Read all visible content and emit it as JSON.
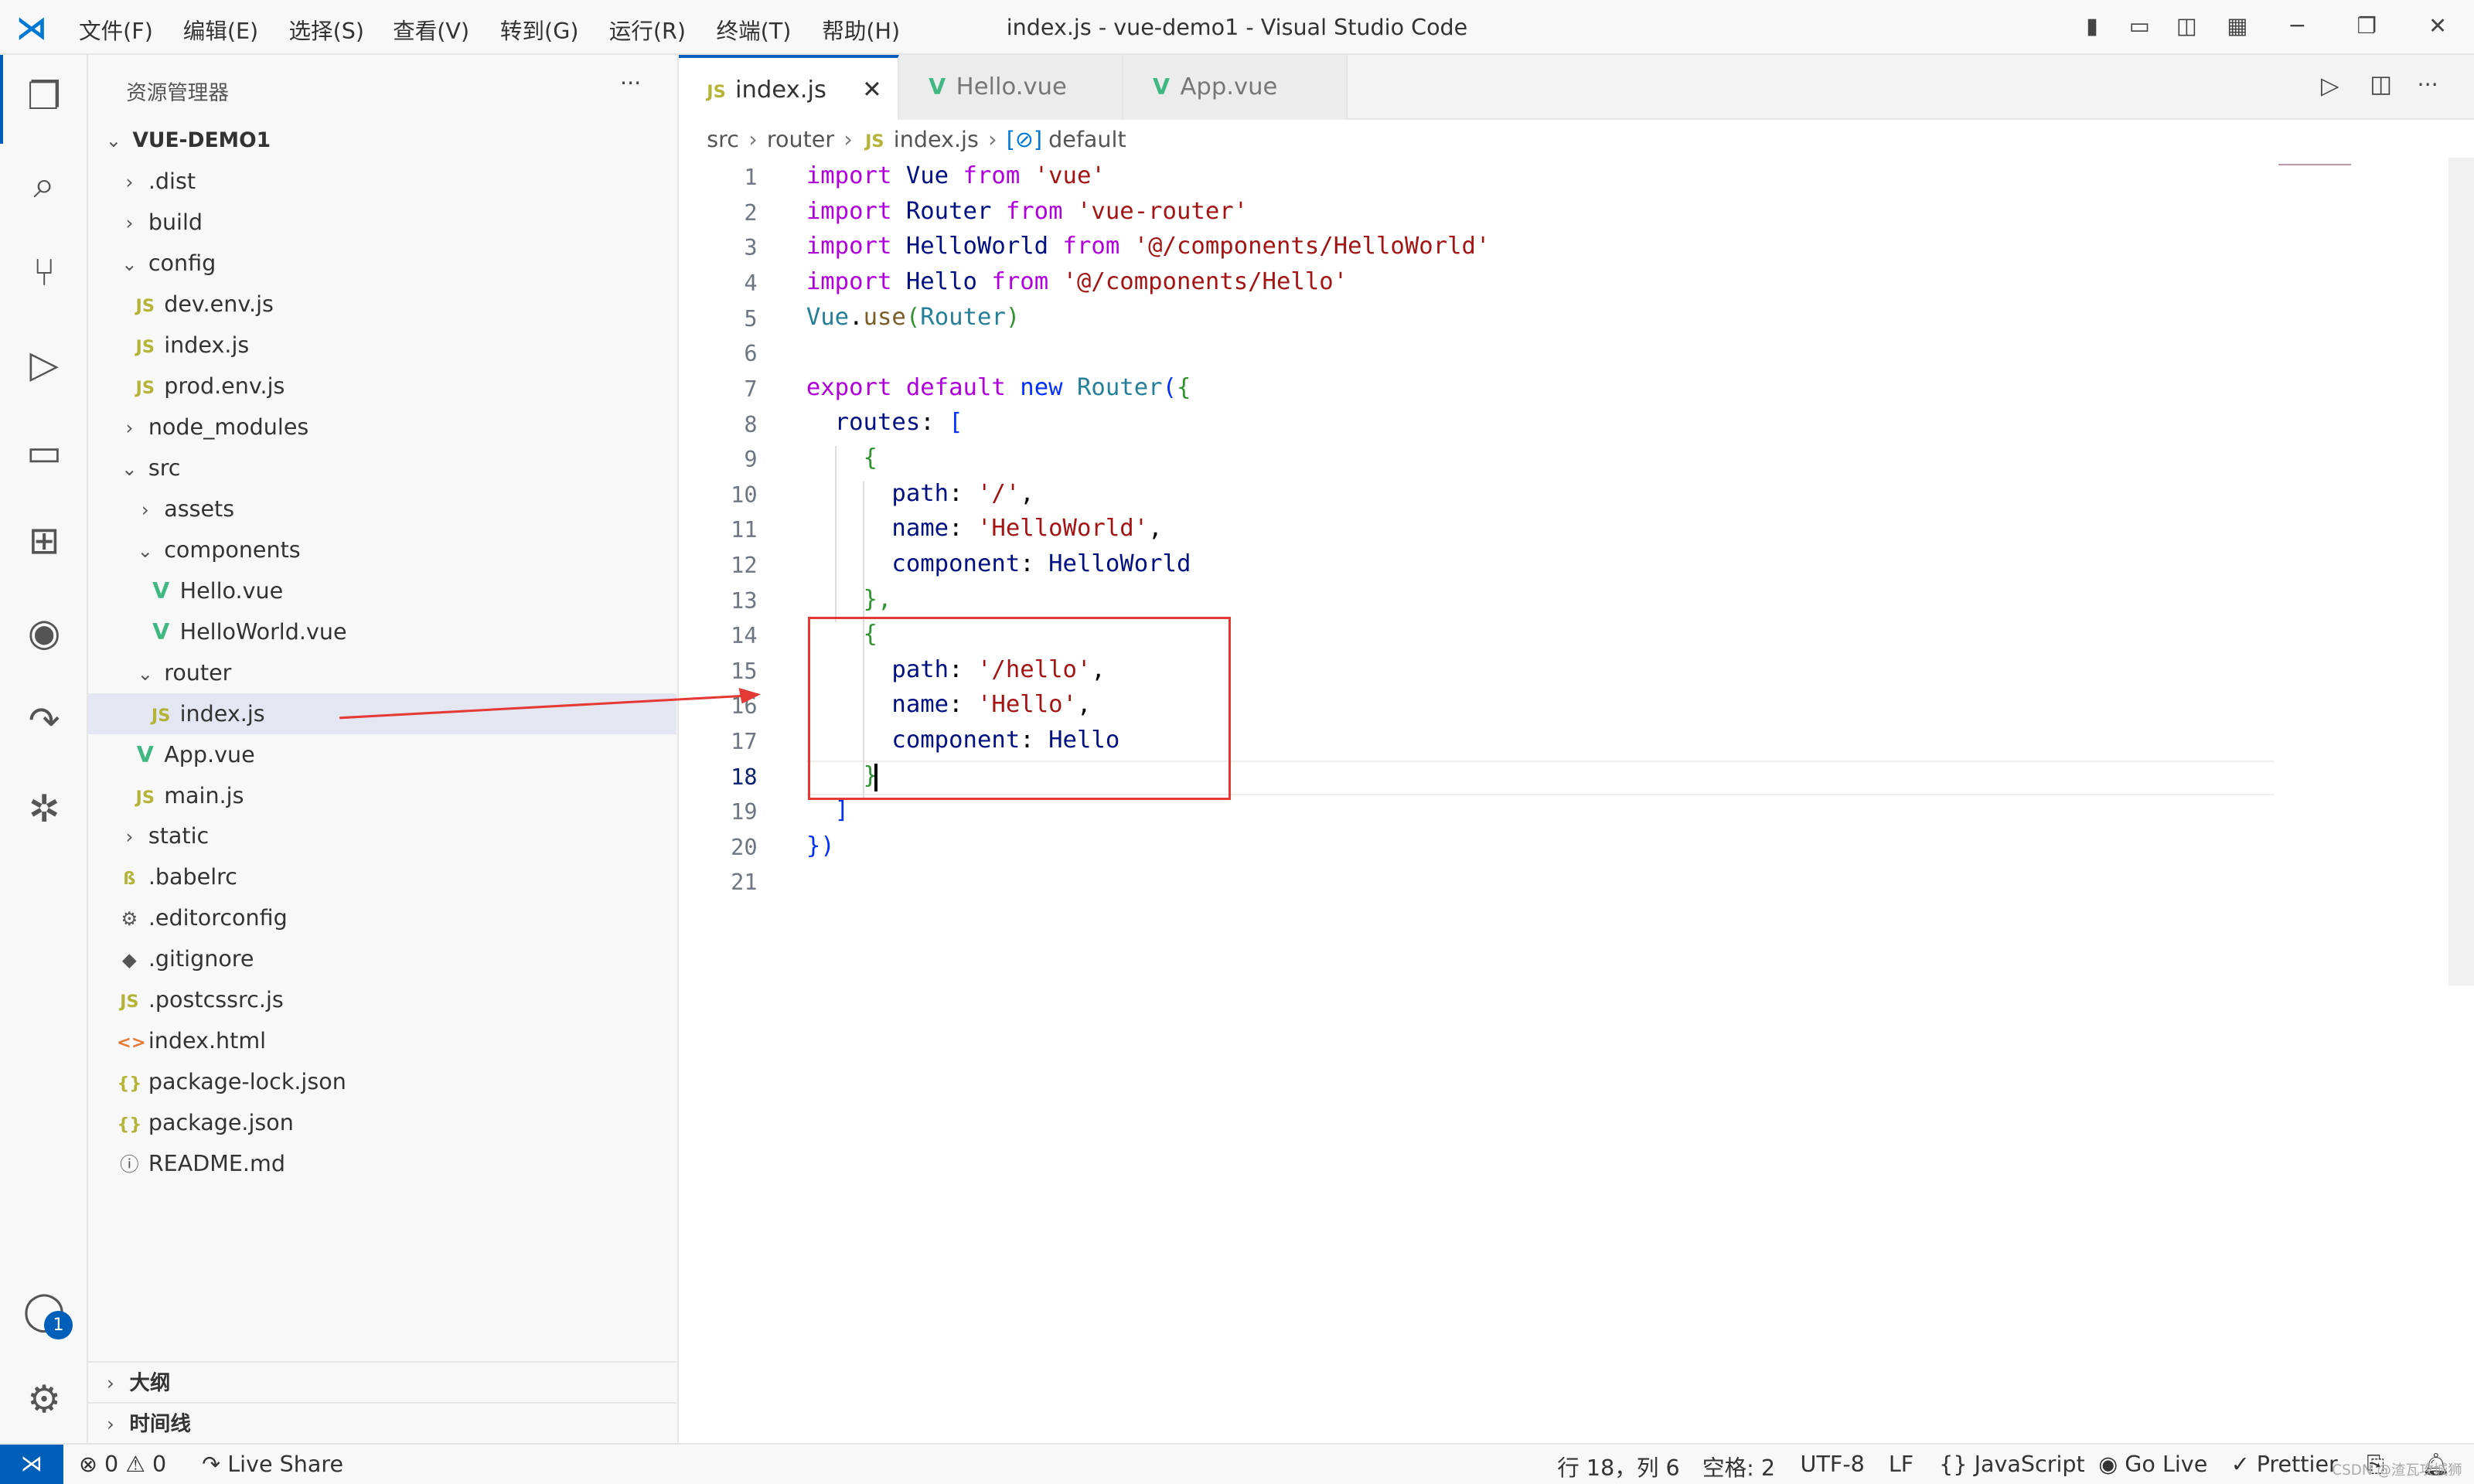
{
  "titlebar": {
    "menus": [
      "文件(F)",
      "编辑(E)",
      "选择(S)",
      "查看(V)",
      "转到(G)",
      "运行(R)",
      "终端(T)",
      "帮助(H)"
    ],
    "title": "index.js - vue-demo1 - Visual Studio Code"
  },
  "sidebar": {
    "header": "资源管理器",
    "more": "···",
    "root": "VUE-DEMO1",
    "items": [
      {
        "label": ".dist",
        "icon": "chevron-right",
        "depth": 1
      },
      {
        "label": "build",
        "icon": "chevron-right",
        "depth": 1
      },
      {
        "label": "config",
        "icon": "chevron-down",
        "depth": 1
      },
      {
        "label": "dev.env.js",
        "icon": "js",
        "depth": 2
      },
      {
        "label": "index.js",
        "icon": "js",
        "depth": 2
      },
      {
        "label": "prod.env.js",
        "icon": "js",
        "depth": 2
      },
      {
        "label": "node_modules",
        "icon": "chevron-right",
        "depth": 1
      },
      {
        "label": "src",
        "icon": "chevron-down",
        "depth": 1
      },
      {
        "label": "assets",
        "icon": "chevron-right",
        "depth": 2
      },
      {
        "label": "components",
        "icon": "chevron-down",
        "depth": 2
      },
      {
        "label": "Hello.vue",
        "icon": "vue",
        "depth": 3
      },
      {
        "label": "HelloWorld.vue",
        "icon": "vue",
        "depth": 3
      },
      {
        "label": "router",
        "icon": "chevron-down",
        "depth": 2
      },
      {
        "label": "index.js",
        "icon": "js",
        "depth": 3,
        "selected": true
      },
      {
        "label": "App.vue",
        "icon": "vue",
        "depth": 2
      },
      {
        "label": "main.js",
        "icon": "js",
        "depth": 2
      },
      {
        "label": "static",
        "icon": "chevron-right",
        "depth": 1
      },
      {
        "label": ".babelrc",
        "icon": "babel",
        "depth": 1
      },
      {
        "label": ".editorconfig",
        "icon": "gear",
        "depth": 1
      },
      {
        "label": ".gitignore",
        "icon": "git",
        "depth": 1
      },
      {
        "label": ".postcssrc.js",
        "icon": "js",
        "depth": 1
      },
      {
        "label": "index.html",
        "icon": "html",
        "depth": 1
      },
      {
        "label": "package-lock.json",
        "icon": "json",
        "depth": 1
      },
      {
        "label": "package.json",
        "icon": "json",
        "depth": 1
      },
      {
        "label": "README.md",
        "icon": "info",
        "depth": 1
      }
    ],
    "outline": "大纲",
    "timeline": "时间线"
  },
  "tabs": [
    {
      "label": "index.js",
      "icon": "js",
      "active": true
    },
    {
      "label": "Hello.vue",
      "icon": "vue"
    },
    {
      "label": "App.vue",
      "icon": "vue"
    }
  ],
  "breadcrumb": [
    "src",
    "router",
    "index.js",
    "default"
  ],
  "editor": {
    "current_line": 18,
    "lines": [
      [
        [
          "import ",
          "k"
        ],
        [
          "Vue ",
          "v"
        ],
        [
          "from ",
          "k"
        ],
        [
          "'vue'",
          "s"
        ]
      ],
      [
        [
          "import ",
          "k"
        ],
        [
          "Router ",
          "v"
        ],
        [
          "from ",
          "k"
        ],
        [
          "'vue-router'",
          "s"
        ]
      ],
      [
        [
          "import ",
          "k"
        ],
        [
          "HelloWorld ",
          "v"
        ],
        [
          "from ",
          "k"
        ],
        [
          "'@/components/HelloWorld'",
          "s"
        ]
      ],
      [
        [
          "import ",
          "k"
        ],
        [
          "Hello ",
          "v"
        ],
        [
          "from ",
          "k"
        ],
        [
          "'@/components/Hello'",
          "s"
        ]
      ],
      [
        [
          "Vue",
          "c"
        ],
        [
          ".",
          "n"
        ],
        [
          "use",
          "f"
        ],
        [
          "(",
          "b"
        ],
        [
          "Router",
          "c"
        ],
        [
          ")",
          "b"
        ]
      ],
      [],
      [
        [
          "export ",
          "k"
        ],
        [
          "default ",
          "k"
        ],
        [
          "new ",
          "p"
        ],
        [
          "Router",
          "c"
        ],
        [
          "(",
          "p"
        ],
        [
          "{",
          "b"
        ]
      ],
      [
        [
          "  routes",
          "v"
        ],
        [
          ": ",
          "n"
        ],
        [
          "[",
          "p"
        ]
      ],
      [
        [
          "    {",
          "b"
        ]
      ],
      [
        [
          "      path",
          "v"
        ],
        [
          ": ",
          "n"
        ],
        [
          "'/'",
          "s"
        ],
        [
          ",",
          "n"
        ]
      ],
      [
        [
          "      name",
          "v"
        ],
        [
          ": ",
          "n"
        ],
        [
          "'HelloWorld'",
          "s"
        ],
        [
          ",",
          "n"
        ]
      ],
      [
        [
          "      component",
          "v"
        ],
        [
          ": ",
          "n"
        ],
        [
          "HelloWorld",
          "v"
        ]
      ],
      [
        [
          "    },",
          "b"
        ]
      ],
      [
        [
          "    {",
          "b"
        ]
      ],
      [
        [
          "      path",
          "v"
        ],
        [
          ": ",
          "n"
        ],
        [
          "'/hello'",
          "s"
        ],
        [
          ",",
          "n"
        ]
      ],
      [
        [
          "      name",
          "v"
        ],
        [
          ": ",
          "n"
        ],
        [
          "'Hello'",
          "s"
        ],
        [
          ",",
          "n"
        ]
      ],
      [
        [
          "      component",
          "v"
        ],
        [
          ": ",
          "n"
        ],
        [
          "Hello",
          "v"
        ]
      ],
      [
        [
          "    }",
          "b"
        ]
      ],
      [
        [
          "  ]",
          "p"
        ]
      ],
      [
        [
          "})",
          "p"
        ]
      ],
      []
    ]
  },
  "statusbar": {
    "errors": "0",
    "warnings": "0",
    "live_share": "Live Share",
    "position": "行 18，列 6",
    "spaces": "空格: 2",
    "encoding": "UTF-8",
    "eol": "LF",
    "language": "JavaScript",
    "go_live": "Go Live",
    "prettier": "Prettier",
    "watermark": "CSDN @渣瓦攻城狮"
  },
  "accounts_badge": "1",
  "annotation_color": "#e53935"
}
